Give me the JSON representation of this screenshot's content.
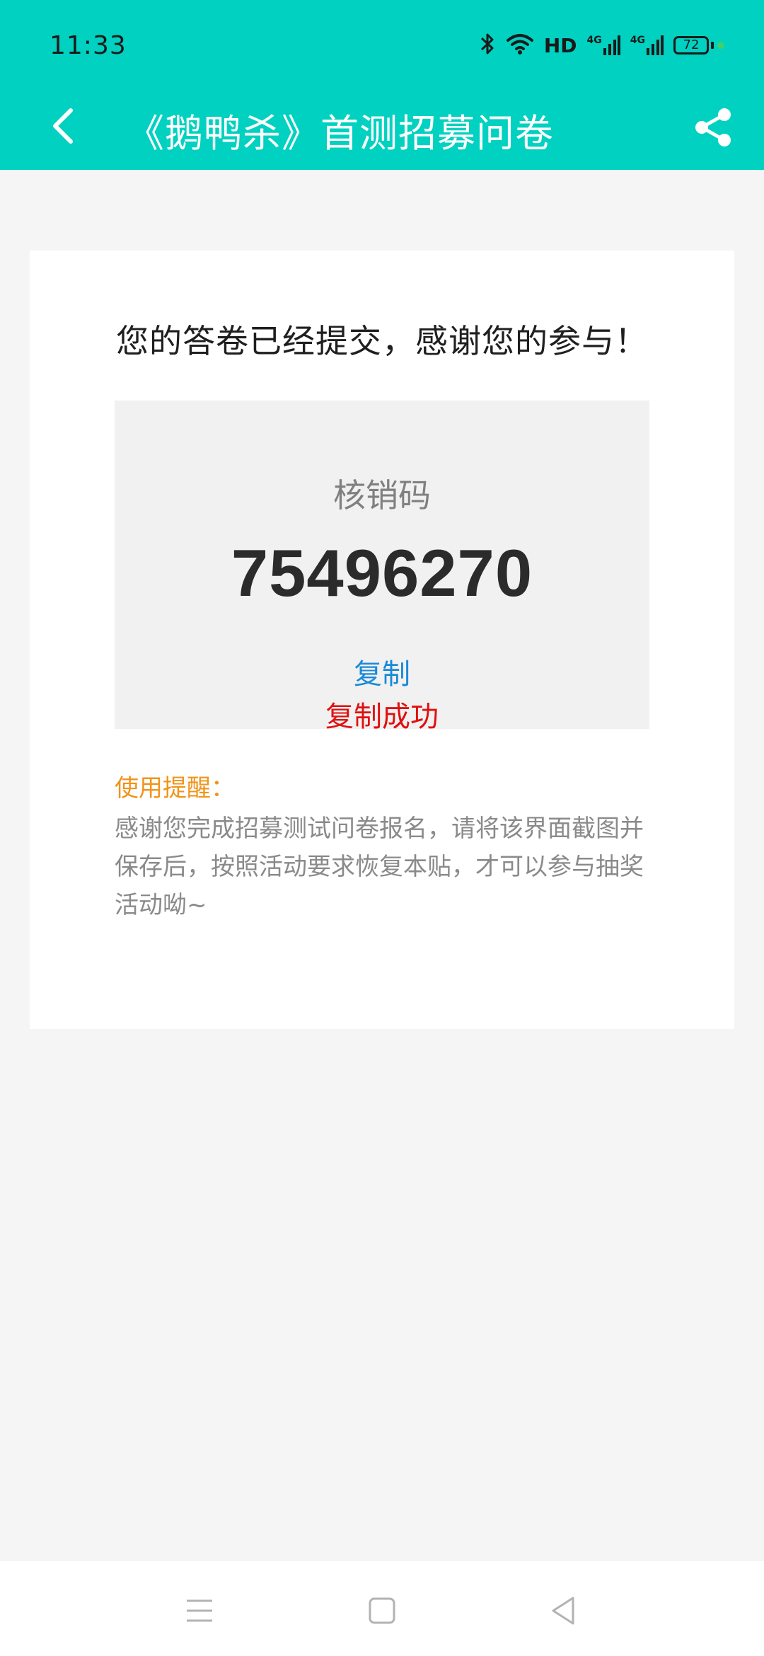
{
  "status_bar": {
    "time": "11:33",
    "network_label": "HD",
    "sim1_label": "4G",
    "sim2_label": "4G",
    "battery_level": "72"
  },
  "header": {
    "title": "《鹅鸭杀》首测招募问卷",
    "accent_color": "#00d1c0"
  },
  "content": {
    "headline": "您的答卷已经提交，感谢您的参与！",
    "code_label": "核销码",
    "code_value": "75496270",
    "copy_label": "复制",
    "copy_success": "复制成功",
    "reminder_title": "使用提醒：",
    "reminder_text": "感谢您完成招募测试问卷报名，请将该界面截图并保存后，按照活动要求恢复本贴，才可以参与抽奖活动呦~"
  },
  "icons": {
    "back": "back-arrow-icon",
    "share": "share-icon",
    "bluetooth": "bluetooth-icon",
    "wifi": "wifi-icon",
    "signal": "signal-icon",
    "battery": "battery-icon",
    "nav_menu": "menu-icon",
    "nav_home": "home-icon",
    "nav_back": "back-triangle-icon"
  }
}
